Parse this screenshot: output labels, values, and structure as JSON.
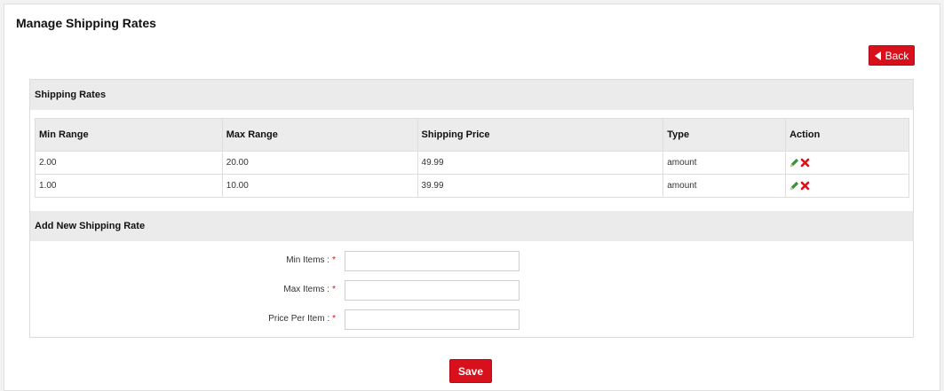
{
  "page": {
    "title": "Manage Shipping Rates"
  },
  "back_button": {
    "label": "Back",
    "icon": "arrow-left-icon"
  },
  "rates_section": {
    "title": "Shipping Rates",
    "columns": [
      "Min Range",
      "Max Range",
      "Shipping Price",
      "Type",
      "Action"
    ],
    "rows": [
      {
        "min": "2.00",
        "max": "20.00",
        "price": "49.99",
        "type": "amount"
      },
      {
        "min": "1.00",
        "max": "10.00",
        "price": "39.99",
        "type": "amount"
      }
    ],
    "action_icons": [
      "edit-icon",
      "delete-icon"
    ]
  },
  "add_section": {
    "title": "Add New Shipping Rate",
    "fields": [
      {
        "label": "Min Items :",
        "required_mark": "*",
        "value": ""
      },
      {
        "label": "Max Items :",
        "required_mark": "*",
        "value": ""
      },
      {
        "label": "Price Per Item :",
        "required_mark": "*",
        "value": ""
      }
    ]
  },
  "save_button": {
    "label": "Save"
  },
  "colors": {
    "accent": "#d8101b",
    "header_bg": "#ebebeb",
    "edit_icon": "#3a9a3a",
    "delete_icon": "#d8101b"
  }
}
